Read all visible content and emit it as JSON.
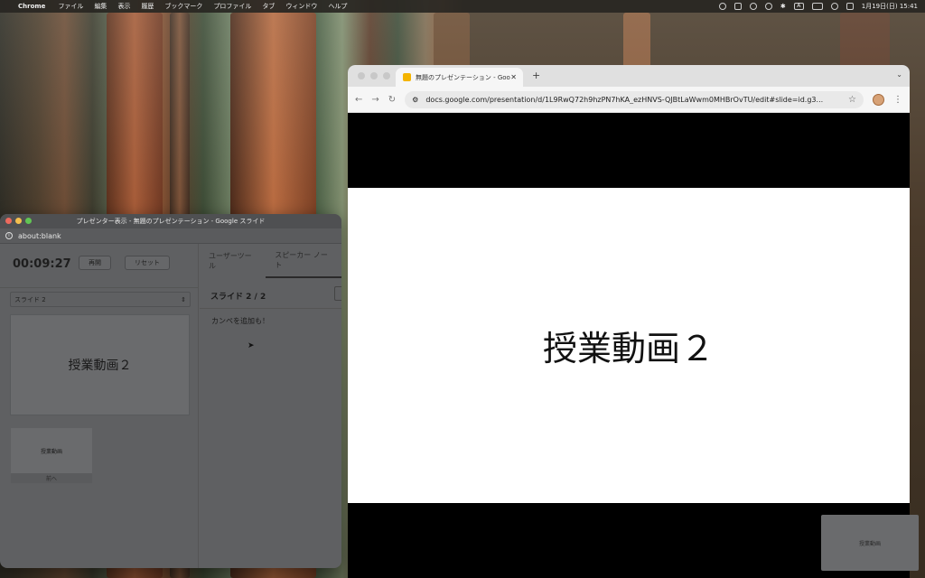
{
  "menubar": {
    "app_name": "Chrome",
    "items": [
      "ファイル",
      "編集",
      "表示",
      "履歴",
      "ブックマーク",
      "プロファイル",
      "タブ",
      "ウィンドウ",
      "ヘルプ"
    ],
    "status_a": "A",
    "clock": "1月19日(日)  15:41"
  },
  "presenter": {
    "window_title": "プレゼンター表示 - 無題のプレゼンテーション - Google スライド",
    "url": "about:blank",
    "timer": "00:09:27",
    "resume_label": "再開",
    "reset_label": "リセット",
    "slide_select_value": "スライド 2",
    "current_slide_text": "授業動画２",
    "previous_slide_text": "授業動画",
    "previous_label": "前へ",
    "tabs": [
      {
        "label": "ユーザーツール",
        "active": false
      },
      {
        "label": "スピーカー ノート",
        "active": true
      }
    ],
    "notes_header": "スライド 2 / 2",
    "notes_text": "カンペを追加も！"
  },
  "chrome": {
    "tab_title": "無題のプレゼンテーション - Goo",
    "url": "docs.google.com/presentation/d/1L9RwQ72h9hzPN7hKA_ezHNVS-QJBtLaWwm0MHBrOvTU/edit#slide=id.g3...",
    "slide_text": "授業動画２"
  },
  "next_thumb_text": "授業動画",
  "colors": {
    "slide_bg": "#ffffff",
    "presenter_bg": "#5f6062",
    "favicon": "#f4b400",
    "close_light": "#ec6a5e",
    "minimize_light": "#f4bf4f",
    "zoom_light": "#61c554"
  }
}
